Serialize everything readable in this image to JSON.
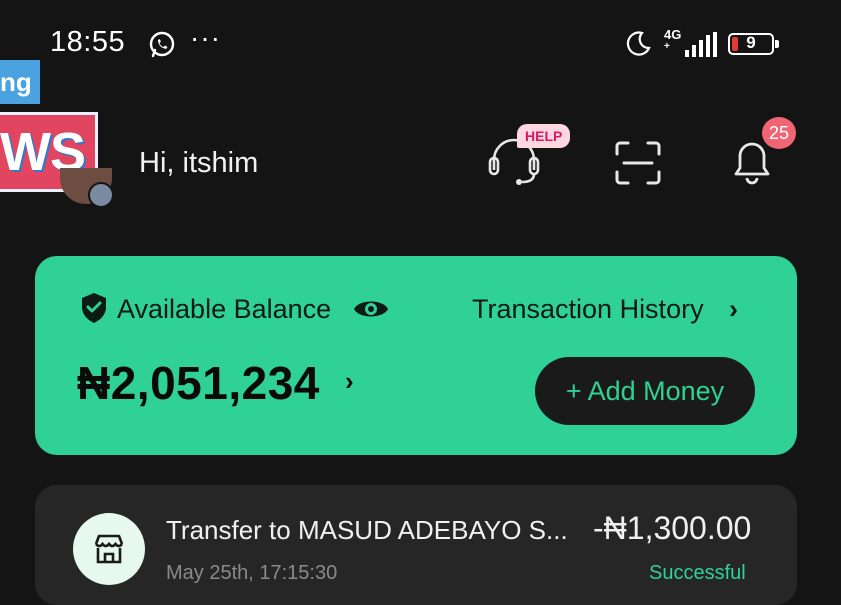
{
  "status_bar": {
    "time": "18:55",
    "more": "···",
    "network": "4G",
    "network_sub": "+",
    "battery_level": "9",
    "icons": [
      "whatsapp-icon",
      "moon-icon",
      "signal-icon",
      "battery-icon"
    ]
  },
  "overlay": {
    "top_text": "ng",
    "main_text": "WS"
  },
  "header": {
    "greeting": "Hi, itshim",
    "help_label": "HELP",
    "notification_count": "25",
    "icons": [
      "headset-icon",
      "scan-icon",
      "bell-icon"
    ]
  },
  "balance_card": {
    "label": "Available Balance",
    "history_link": "Transaction History",
    "chevron": "›",
    "amount": "₦2,051,234",
    "add_money_label": "+ Add Money",
    "icons": [
      "shield-check-icon",
      "eye-icon",
      "chevron-right-icon"
    ]
  },
  "transaction": {
    "title": "Transfer to MASUD ADEBAYO S...",
    "amount": "-₦1,300.00",
    "date": "May 25th, 17:15:30",
    "status": "Successful",
    "icon": "store-icon"
  },
  "colors": {
    "background": "#141414",
    "accent": "#2fd197",
    "card_dark": "#262626",
    "notification_red": "#f06474",
    "help_pink": "#d81b60"
  }
}
